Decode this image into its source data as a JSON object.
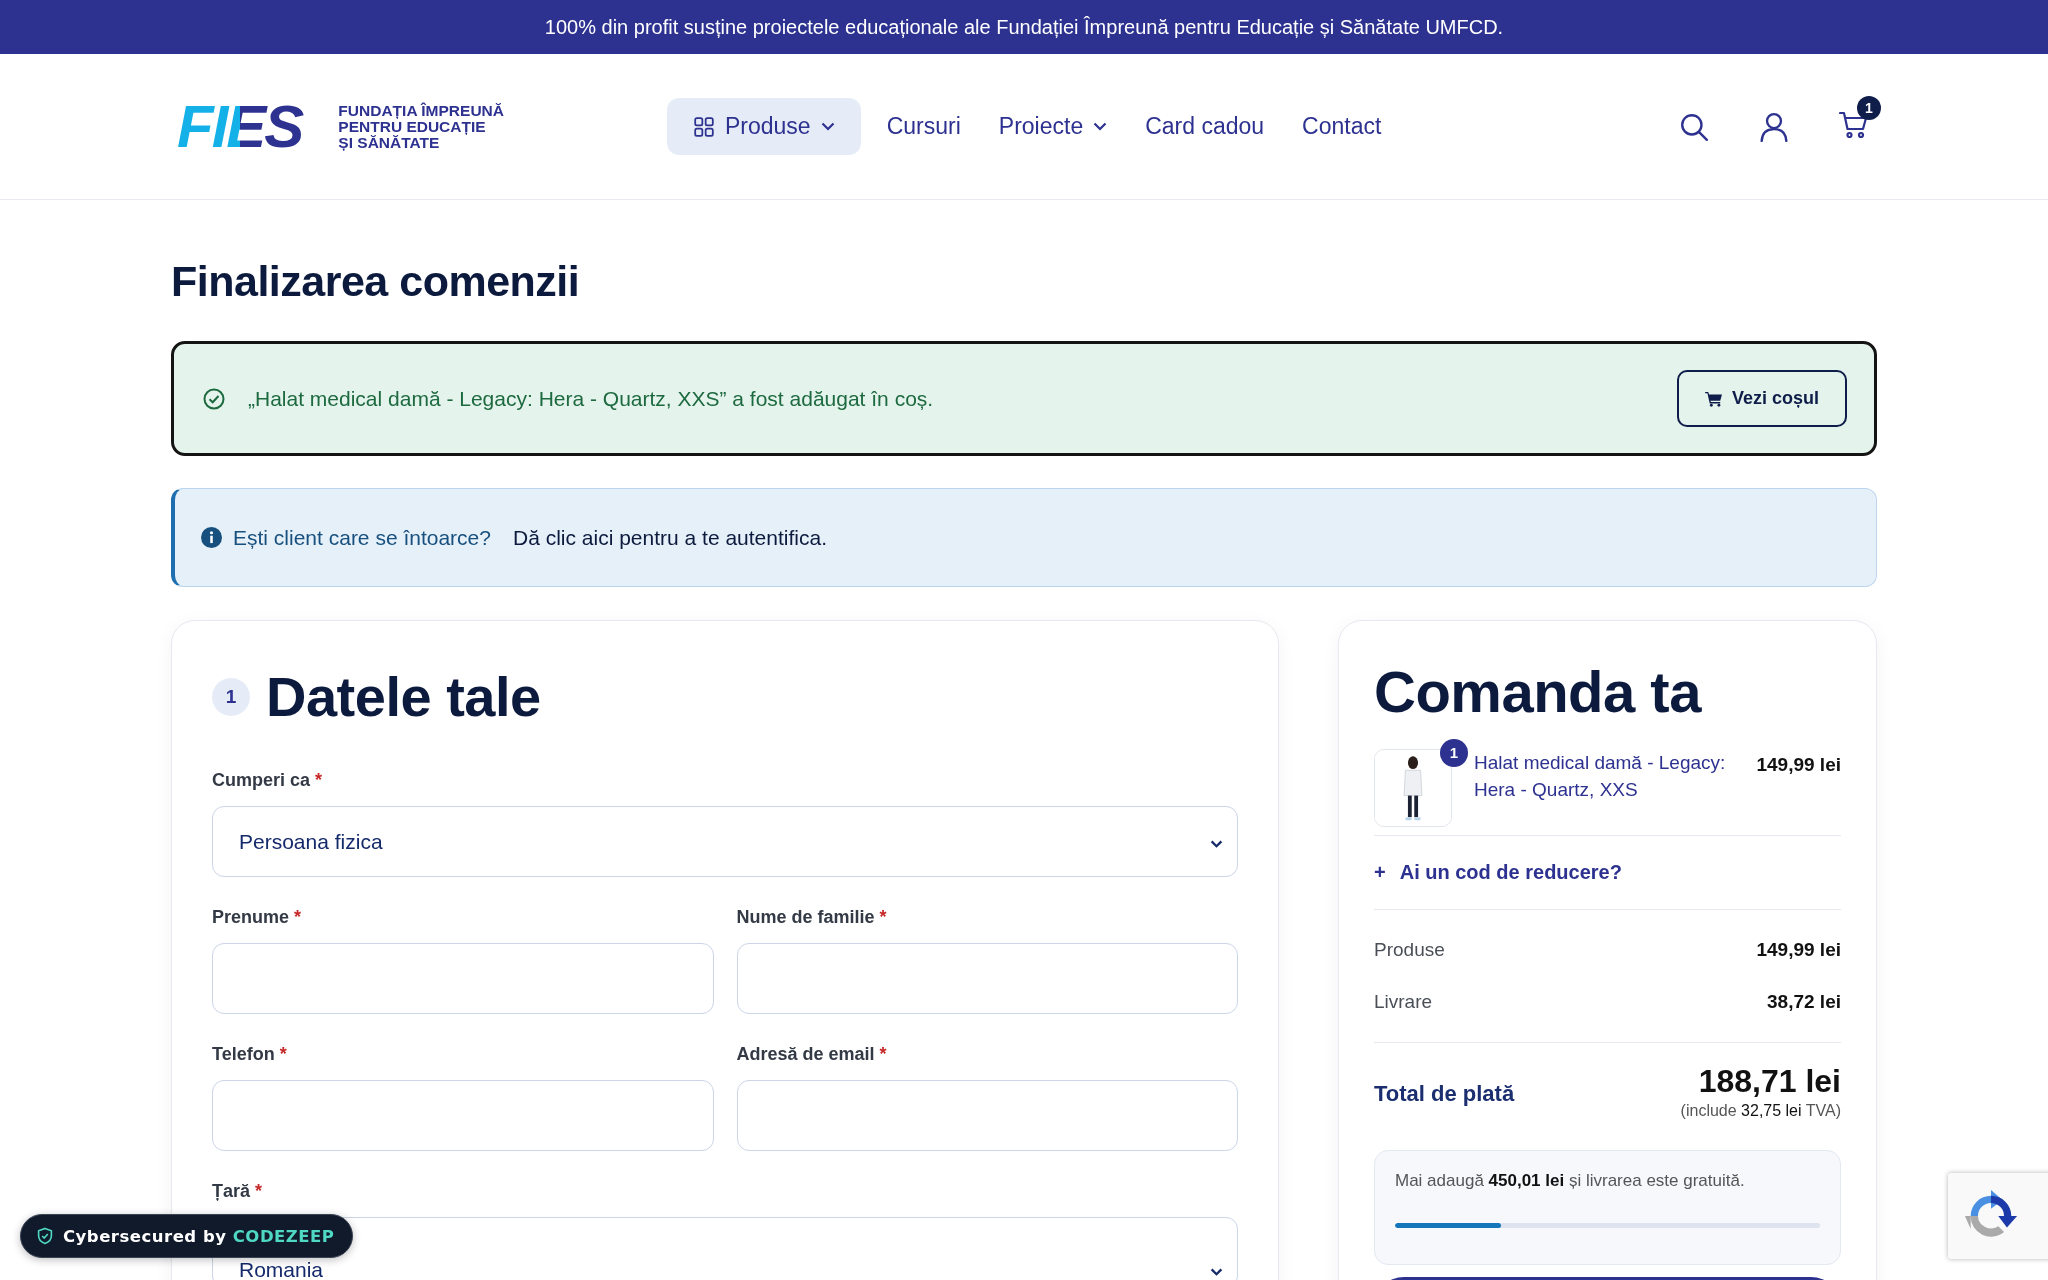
{
  "announcement": "100% din profit susține proiectele educaționale ale Fundației Împreună pentru Educație și Sănătate UMFCD.",
  "logo": {
    "wordmark": "FIES",
    "lines": [
      "FUNDAȚIA ÎMPREUNĂ",
      "PENTRU EDUCAȚIE",
      "ȘI SĂNĂTATE"
    ]
  },
  "nav": [
    {
      "label": "Produse",
      "kind": "menu",
      "selected": true,
      "dropdown": true
    },
    {
      "label": "Cursuri",
      "kind": "link",
      "selected": false,
      "dropdown": false
    },
    {
      "label": "Proiecte",
      "kind": "link",
      "selected": false,
      "dropdown": true
    },
    {
      "label": "Card cadou",
      "kind": "link",
      "selected": false,
      "dropdown": false
    },
    {
      "label": "Contact",
      "kind": "link",
      "selected": false,
      "dropdown": false
    }
  ],
  "cart_count": "1",
  "page_title": "Finalizarea comenzii",
  "success_notice": {
    "message": "„Halat medical damă - Legacy: Hera - Quartz, XXS” a fost adăugat în coș.",
    "button": "Vezi coșul"
  },
  "info_notice": {
    "question": "Ești client care se întoarce?",
    "link": "Dă clic aici pentru a te autentifica."
  },
  "form": {
    "step": "1",
    "title": "Datele tale",
    "required_mark": "*",
    "rows": [
      [
        {
          "label": "Cumperi ca",
          "kind": "select",
          "required": true,
          "value": "Persoana fizica"
        }
      ],
      [
        {
          "label": "Prenume",
          "kind": "text",
          "required": true
        },
        {
          "label": "Nume de familie",
          "kind": "text",
          "required": true
        }
      ],
      [
        {
          "label": "Telefon",
          "kind": "text",
          "required": true
        },
        {
          "label": "Adresă de email",
          "kind": "text",
          "required": true
        }
      ],
      [
        {
          "label": "Țară",
          "kind": "select",
          "required": true,
          "value": "Romania"
        }
      ]
    ]
  },
  "order": {
    "title": "Comanda ta",
    "item": {
      "quantity": "1",
      "name": "Halat medical damă - Legacy: Hera - Quartz, XXS",
      "price": "149,99 lei"
    },
    "coupon": {
      "icon": "+",
      "label": "Ai un cod de reducere?"
    },
    "lines": [
      {
        "label": "Produse",
        "value": "149,99 lei"
      },
      {
        "label": "Livrare",
        "value": "38,72 lei"
      }
    ],
    "total": {
      "label": "Total de plată",
      "value": "188,71 lei",
      "note": "(include **32,75 lei** TVA)"
    },
    "free_shipping": {
      "message": "Mai adaugă **450,01 lei** și livrarea este gratuită.",
      "level": 0.25
    }
  },
  "security_badge": {
    "prefix": "Cybersecured by",
    "brand": "CODEZEEP"
  }
}
